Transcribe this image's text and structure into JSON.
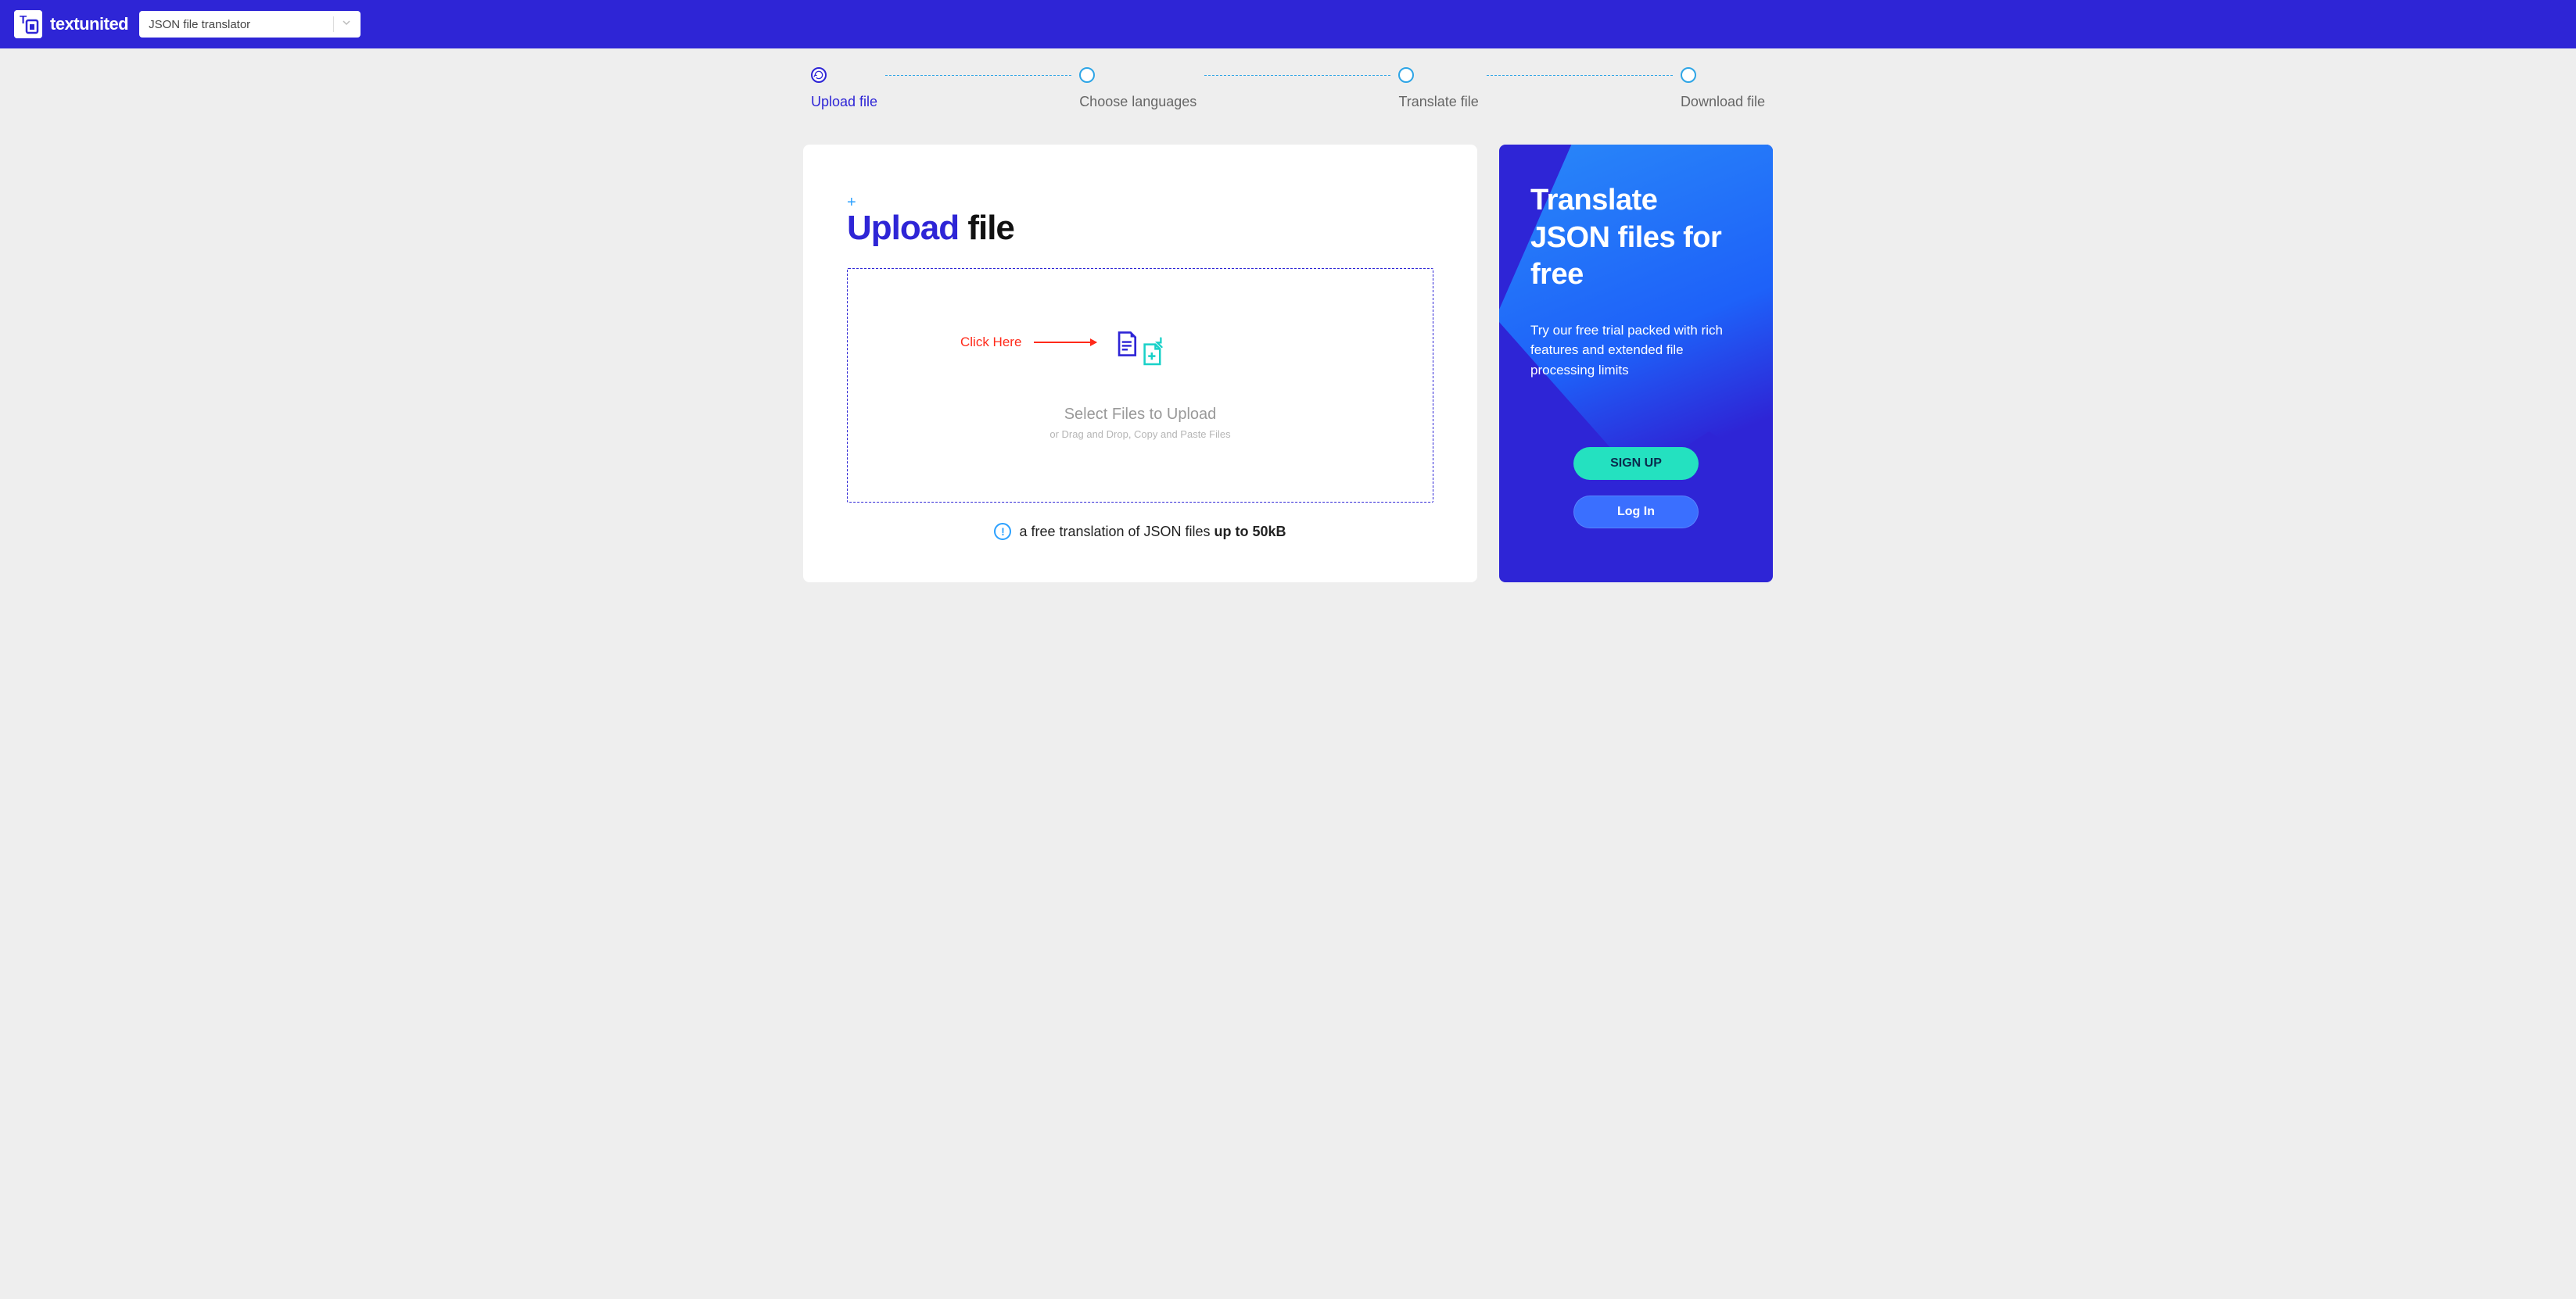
{
  "header": {
    "brand": "textunited",
    "dropdown_selected": "JSON file translator"
  },
  "stepper": {
    "items": [
      {
        "label": "Upload file"
      },
      {
        "label": "Choose languages"
      },
      {
        "label": "Translate file"
      },
      {
        "label": "Download file"
      }
    ]
  },
  "main": {
    "title_highlight": "Upload",
    "title_rest": " file",
    "annotation_text": "Click Here",
    "dropzone_main": "Select Files to Upload",
    "dropzone_sub": "or Drag and Drop, Copy and Paste Files",
    "footnote_pre": "a free translation of JSON files ",
    "footnote_bold": "up to 50kB"
  },
  "promo": {
    "title": "Translate JSON files for free",
    "body": "Try our free trial packed with rich features and extended file processing limits",
    "signup_label": "SIGN UP",
    "login_label": "Log In"
  }
}
